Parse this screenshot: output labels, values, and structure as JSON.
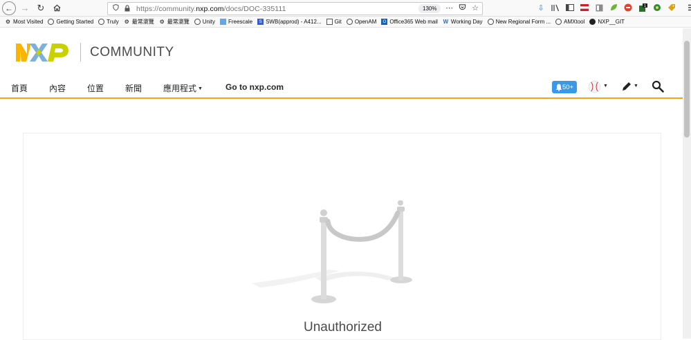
{
  "browser": {
    "url_prefix": "https://community.",
    "url_domain": "nxp.com",
    "url_path": "/docs/DOC-335111",
    "zoom": "130%",
    "bookmarks": [
      {
        "label": "Most Visited",
        "icon": "gear-icon"
      },
      {
        "label": "Getting Started",
        "icon": "globe-icon"
      },
      {
        "label": "Truly",
        "icon": "globe-icon"
      },
      {
        "label": "最常瀏覽",
        "icon": "gear-icon"
      },
      {
        "label": "最常瀏覽",
        "icon": "gear-icon"
      },
      {
        "label": "Unity",
        "icon": "globe-icon"
      },
      {
        "label": "Freescale",
        "icon": "folder-icon"
      },
      {
        "label": "SWB(approd) - A412...",
        "icon": "swb-icon"
      },
      {
        "label": "Git",
        "icon": "folder-icon"
      },
      {
        "label": "OpenAM",
        "icon": "globe-icon"
      },
      {
        "label": "Office365 Web mail",
        "icon": "outlook-icon"
      },
      {
        "label": "Working Day",
        "icon": "workday-icon"
      },
      {
        "label": "New Regional Form ...",
        "icon": "globe-icon"
      },
      {
        "label": "AMXtool",
        "icon": "globe-icon"
      },
      {
        "label": "NXP__GIT",
        "icon": "github-icon"
      }
    ]
  },
  "header": {
    "community": "COMMUNITY"
  },
  "nav": {
    "home": "首頁",
    "content": "內容",
    "places": "位置",
    "news": "新聞",
    "apps": "應用程式",
    "goto": "Go to nxp.com",
    "notifications": "50+"
  },
  "main": {
    "heading": "Unauthorized"
  },
  "colors": {
    "accent": "#f5a313",
    "notif": "#3899e8"
  }
}
